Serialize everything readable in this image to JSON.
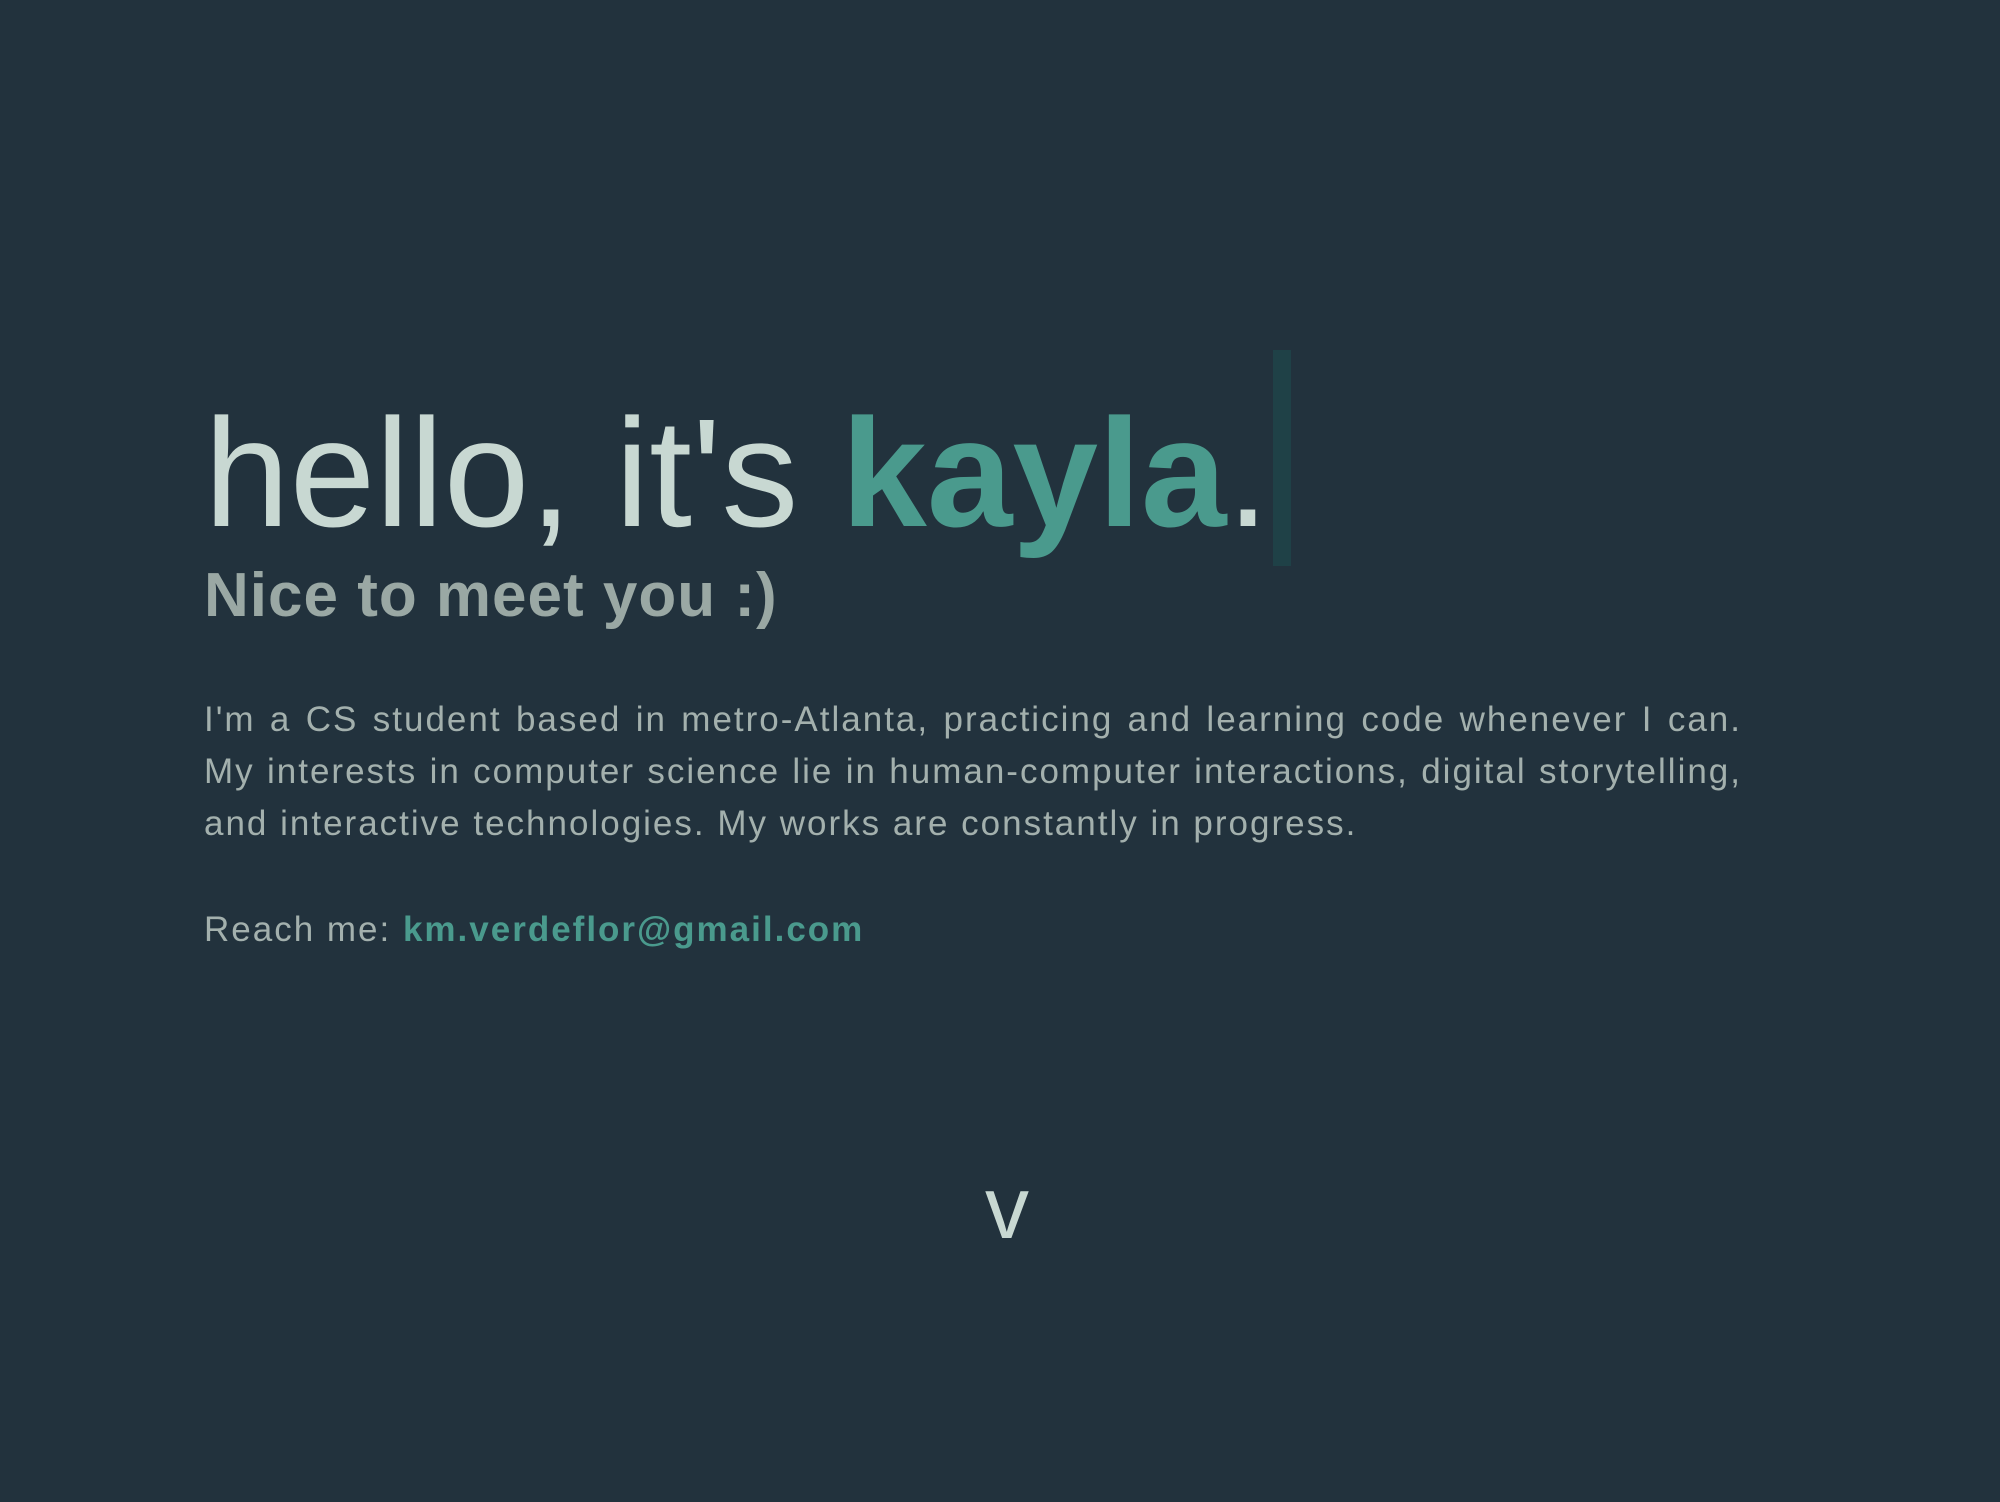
{
  "hero": {
    "greeting": "hello, it's ",
    "name": "kayla",
    "punctuation": ".",
    "subtitle": "Nice to meet you :)",
    "bio": "I'm a CS student based in metro-Atlanta, practicing and learning code whenever I can. My interests in computer science lie in human-computer interactions, digital storytelling, and interactive technologies. My works are constantly in progress.",
    "contact_label": "Reach me: ",
    "email": "km.verdeflor@gmail.com"
  },
  "scroll": {
    "label": "v"
  },
  "colors": {
    "background": "#22323d",
    "accent": "#4a9a8d",
    "headline": "#c8d8d2",
    "body_text": "#a3b0ad",
    "cursor": "#1f4147"
  }
}
